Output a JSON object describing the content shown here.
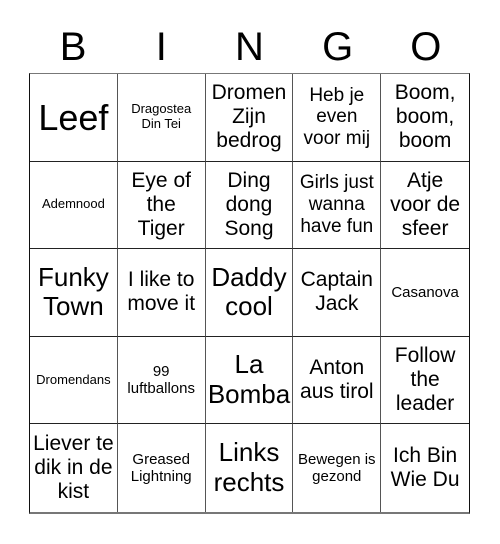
{
  "header": {
    "letters": [
      "B",
      "I",
      "N",
      "G",
      "O"
    ]
  },
  "card": {
    "rows": [
      [
        "Leef",
        "Dragostea Din Tei",
        "Dromen Zijn bedrog",
        "Heb je even voor mij",
        "Boom, boom, boom"
      ],
      [
        "Ademnood",
        "Eye of the Tiger",
        "Ding dong Song",
        "Girls just wanna have fun",
        "Atje voor de sfeer"
      ],
      [
        "Funky Town",
        "I like to move it",
        "Daddy cool",
        "Captain Jack",
        "Casanova"
      ],
      [
        "Dromendans",
        "99 luftballons",
        "La Bomba",
        "Anton aus tirol",
        "Follow the leader"
      ],
      [
        "Liever te dik in de kist",
        "Greased Lightning",
        "Links rechts",
        "Bewegen is gezond",
        "Ich Bin Wie Du"
      ]
    ]
  }
}
